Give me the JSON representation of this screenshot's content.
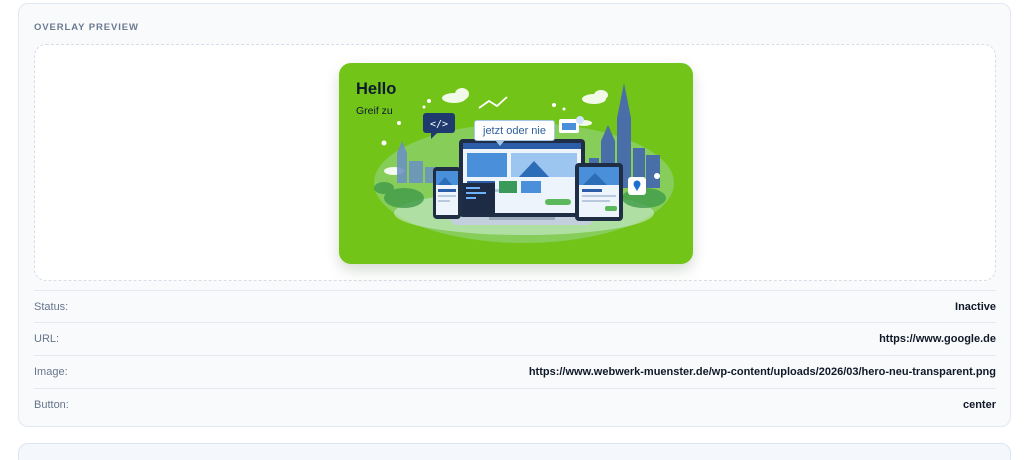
{
  "panel": {
    "title": "OVERLAY PREVIEW"
  },
  "overlay": {
    "heading": "Hello",
    "subheading": "Greif zu",
    "bubble_text": "jetzt oder nie",
    "code_badge": "</>",
    "background_color": "#72c418",
    "illustration": "laptop-phone-tablet-website-city-illustration"
  },
  "details": [
    {
      "label": "Status:",
      "value": "Inactive"
    },
    {
      "label": "URL:",
      "value": "https://www.google.de"
    },
    {
      "label": "Image:",
      "value": "https://www.webwerk-muenster.de/wp-content/uploads/2026/03/hero-neu-transparent.png"
    },
    {
      "label": "Button:",
      "value": "center"
    }
  ]
}
